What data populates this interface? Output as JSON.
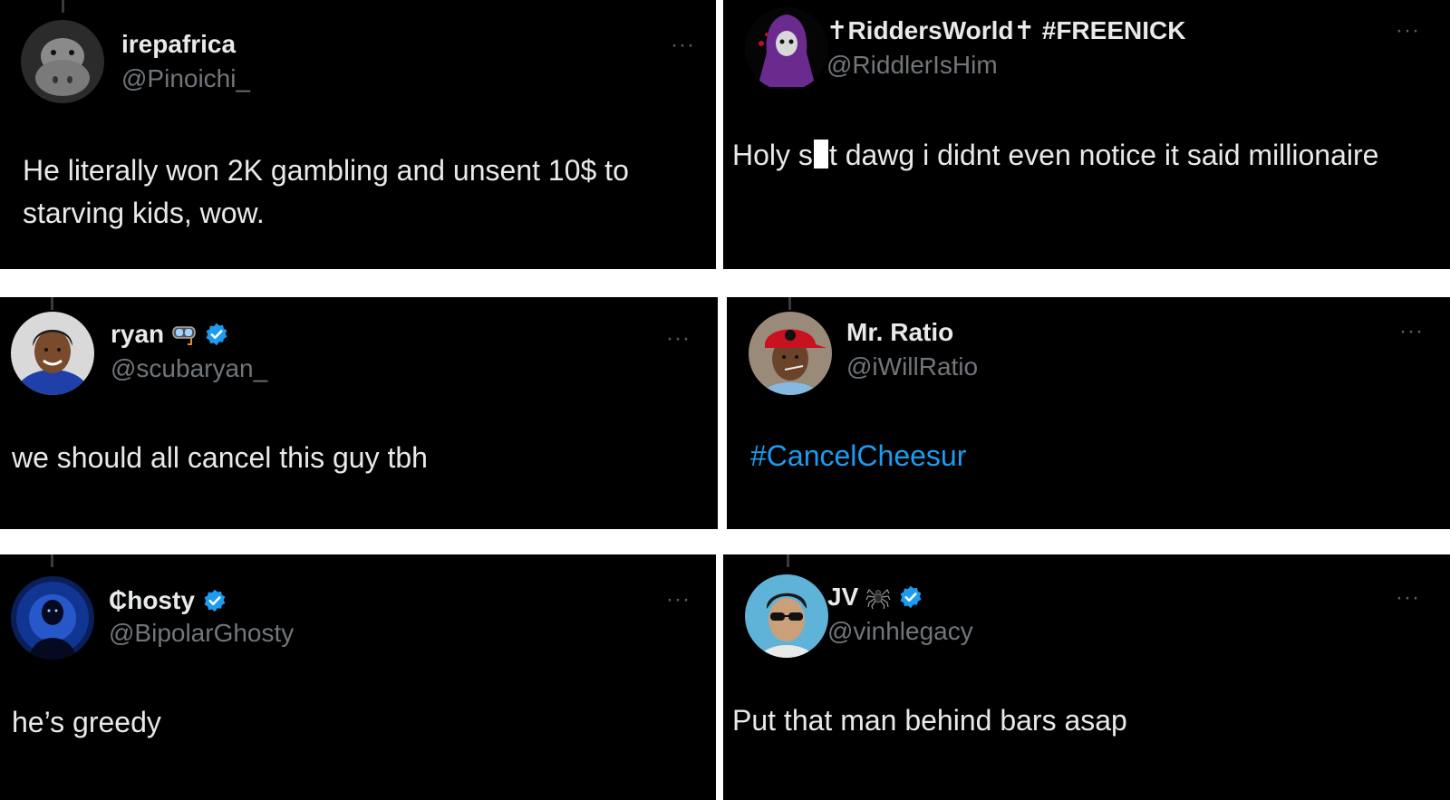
{
  "tweets": [
    {
      "name": "irepafrica",
      "handle": "@Pinoichi_",
      "text": "He literally won 2K gambling and unsent 10$ to starving kids, wow.",
      "avatar": "hippo-avatar",
      "verified": false
    },
    {
      "name": "✝RiddersWorld✝ #FREENICK",
      "handle": "@RiddlerIsHim",
      "text_before": "Holy s",
      "text_after": "t dawg i didnt even notice it said millionaire",
      "avatar": "purple-hooded-figure-avatar",
      "verified": false
    },
    {
      "name": "ryan",
      "handle": "@scubaryan_",
      "text": "we should all cancel this guy tbh",
      "avatar": "smiling-man-avatar",
      "emoji": "diving-mask-icon",
      "verified": true
    },
    {
      "name": "Mr. Ratio",
      "handle": "@iWillRatio",
      "text": "#CancelCheesur",
      "avatar": "red-cap-avatar",
      "verified": false
    },
    {
      "name": "₵hosty",
      "handle": "@BipolarGhosty",
      "text": "he’s greedy",
      "avatar": "blue-silhouette-avatar",
      "verified": true
    },
    {
      "name": "JV",
      "handle": "@vinhlegacy",
      "text": "Put that man behind bars asap",
      "avatar": "sunglasses-avatar",
      "emoji": "spider-icon",
      "verified": true
    }
  ],
  "more_label": "···",
  "colors": {
    "background": "#000000",
    "name": "#e7e9ea",
    "handle": "#71767b",
    "hashtag": "#1d9bf0",
    "verified": "#1d9bf0"
  }
}
